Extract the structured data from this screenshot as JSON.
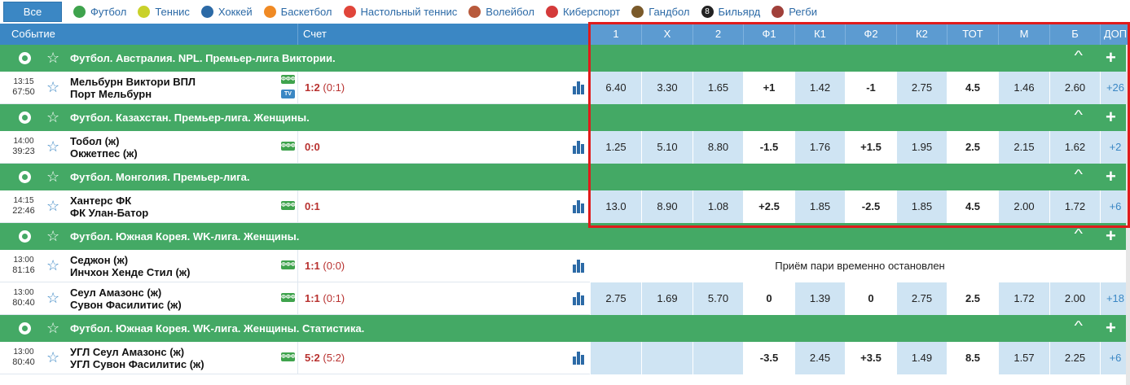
{
  "sports_bar": {
    "all_label": "Все",
    "sports": [
      {
        "label": "Футбол",
        "icon": "soccer-ball-icon",
        "color": "#3fa34d"
      },
      {
        "label": "Теннис",
        "icon": "tennis-ball-icon",
        "color": "#c9d12a"
      },
      {
        "label": "Хоккей",
        "icon": "hockey-puck-icon",
        "color": "#2c6aa6"
      },
      {
        "label": "Баскетбол",
        "icon": "basketball-icon",
        "color": "#f08a24"
      },
      {
        "label": "Настольный теннис",
        "icon": "table-tennis-icon",
        "color": "#e0453a"
      },
      {
        "label": "Волейбол",
        "icon": "volleyball-icon",
        "color": "#b85a3c"
      },
      {
        "label": "Киберспорт",
        "icon": "gamepad-icon",
        "color": "#d43a3a"
      },
      {
        "label": "Гандбол",
        "icon": "handball-player-icon",
        "color": "#7a5a2a"
      },
      {
        "label": "Бильярд",
        "icon": "eight-ball-icon",
        "color": "#222222"
      },
      {
        "label": "Регби",
        "icon": "rugby-ball-icon",
        "color": "#a0403a"
      }
    ]
  },
  "header": {
    "event": "Событие",
    "score": "Счет",
    "cols": [
      "1",
      "X",
      "2",
      "Ф1",
      "К1",
      "Ф2",
      "К2",
      "ТОТ",
      "М",
      "Б",
      "ДОП"
    ]
  },
  "leagues": [
    {
      "name": "Футбол. Австралия. NPL. Премьер-лига Виктории.",
      "matches": [
        {
          "time": "13:15",
          "clock": "67:50",
          "team1": "Мельбурн Виктори ВПЛ",
          "team2": "Порт Мельбурн",
          "tv": true,
          "score_main": "1:2",
          "score_half": "(0:1)",
          "odds": [
            "6.40",
            "3.30",
            "1.65",
            "+1",
            "1.42",
            "-1",
            "2.75",
            "4.5",
            "1.46",
            "2.60",
            "+26"
          ]
        }
      ]
    },
    {
      "name": "Футбол. Казахстан. Премьер-лига. Женщины.",
      "matches": [
        {
          "time": "14:00",
          "clock": "39:23",
          "team1": "Тобол (ж)",
          "team2": "Окжетпес (ж)",
          "tv": false,
          "score_main": "0:0",
          "score_half": "",
          "odds": [
            "1.25",
            "5.10",
            "8.80",
            "-1.5",
            "1.76",
            "+1.5",
            "1.95",
            "2.5",
            "2.15",
            "1.62",
            "+2"
          ]
        }
      ]
    },
    {
      "name": "Футбол. Монголия. Премьер-лига.",
      "matches": [
        {
          "time": "14:15",
          "clock": "22:46",
          "team1": "Хантерс ФК",
          "team2": "ФК Улан-Батор",
          "tv": false,
          "score_main": "0:1",
          "score_half": "",
          "odds": [
            "13.0",
            "8.90",
            "1.08",
            "+2.5",
            "1.85",
            "-2.5",
            "1.85",
            "4.5",
            "2.00",
            "1.72",
            "+6"
          ]
        }
      ]
    },
    {
      "name": "Футбол. Южная Корея. WK-лига. Женщины.",
      "matches": [
        {
          "time": "13:00",
          "clock": "81:16",
          "team1": "Седжон (ж)",
          "team2": "Инчхон Хенде Стил (ж)",
          "tv": false,
          "score_main": "1:1",
          "score_half": "(0:0)",
          "suspended": "Приём пари временно остановлен"
        },
        {
          "time": "13:00",
          "clock": "80:40",
          "team1": "Сеул Амазонс (ж)",
          "team2": "Сувон Фасилитис (ж)",
          "tv": false,
          "score_main": "1:1",
          "score_half": "(0:1)",
          "odds": [
            "2.75",
            "1.69",
            "5.70",
            "0",
            "1.39",
            "0",
            "2.75",
            "2.5",
            "1.72",
            "2.00",
            "+18"
          ]
        }
      ]
    },
    {
      "name": "Футбол. Южная Корея. WK-лига. Женщины. Статистика.",
      "matches": [
        {
          "time": "13:00",
          "clock": "80:40",
          "team1": "УГЛ Сеул Амазонс (ж)",
          "team2": "УГЛ Сувон Фасилитис (ж)",
          "tv": false,
          "score_main": "5:2",
          "score_half": "(5:2)",
          "odds": [
            "",
            "",
            "",
            "-3.5",
            "2.45",
            "+3.5",
            "1.49",
            "8.5",
            "1.57",
            "2.25",
            "+6"
          ]
        }
      ]
    }
  ],
  "badges": {
    "fon": "ФФФ",
    "tv": "TV"
  },
  "colors": {
    "header_blue": "#3b87c4",
    "league_green": "#44a965",
    "odds_light": "#cfe4f3",
    "score_red": "#b8312f",
    "highlight_red": "#e01b1b"
  }
}
